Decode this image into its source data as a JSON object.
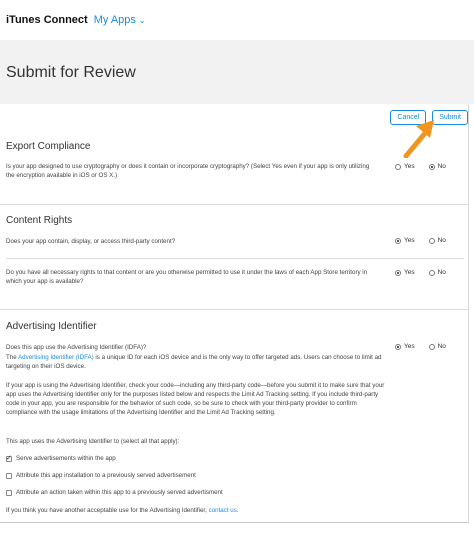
{
  "header": {
    "brand": "iTunes Connect",
    "myapps": "My Apps"
  },
  "page": {
    "title": "Submit for Review"
  },
  "actions": {
    "cancel": "Cancel",
    "submit": "Submit"
  },
  "export": {
    "title": "Export Compliance",
    "question": "Is your app designed to use cryptography or does it contain or incorporate cryptography? (Select Yes even if your app is only utilizing the encryption available in iOS or OS X.)",
    "yes": "Yes",
    "no": "No",
    "selected": "No"
  },
  "content_rights": {
    "title": "Content Rights",
    "q1": "Does your app contain, display, or access third-party content?",
    "q1_selected": "Yes",
    "q2": "Do you have all necessary rights to that content or are you otherwise permitted to use it under the laws of each App Store territory in which your app is available?",
    "q2_selected": "Yes",
    "yes": "Yes",
    "no": "No"
  },
  "advertising": {
    "title": "Advertising Identifier",
    "question": "Does this app use the Advertising Identifier (IDFA)?",
    "selected": "Yes",
    "yes": "Yes",
    "no": "No",
    "para1_pre": "The ",
    "para1_link": "Advertising Identifier (IDFA)",
    "para1_post": " is a unique ID for each iOS device and is the only way to offer targeted ads. Users can choose to limit ad targeting on their iOS device.",
    "para2": "If your app is using the Advertising Identifier, check your code—including any third-party code—before you submit it to make sure that your app uses the Advertising Identifier only for the purposes listed below and respects the Limit Ad Tracking setting. If you include third-party code in your app, you are responsible for the behavior of such code, so be sure to check with your third-party provider to confirm compliance with the usage limitations of the Advertising Identifier and the Limit Ad Tracking setting.",
    "uses_label": "This app uses the Advertising Identifier to (select all that apply):",
    "options": [
      {
        "label": "Serve advertisements within the app",
        "checked": true
      },
      {
        "label": "Attribute this app installation to a previously served advertisement",
        "checked": false
      },
      {
        "label": "Attribute an action taken within this app to a previously served advertisment",
        "checked": false
      }
    ],
    "footer_pre": "If you think you have another acceptable use for the Advertising Identifier, ",
    "footer_link": "contact us",
    "footer_post": "."
  },
  "colors": {
    "accent": "#1a8be0",
    "arrow": "#f0961e",
    "titlebar": "#f2f2f2"
  }
}
